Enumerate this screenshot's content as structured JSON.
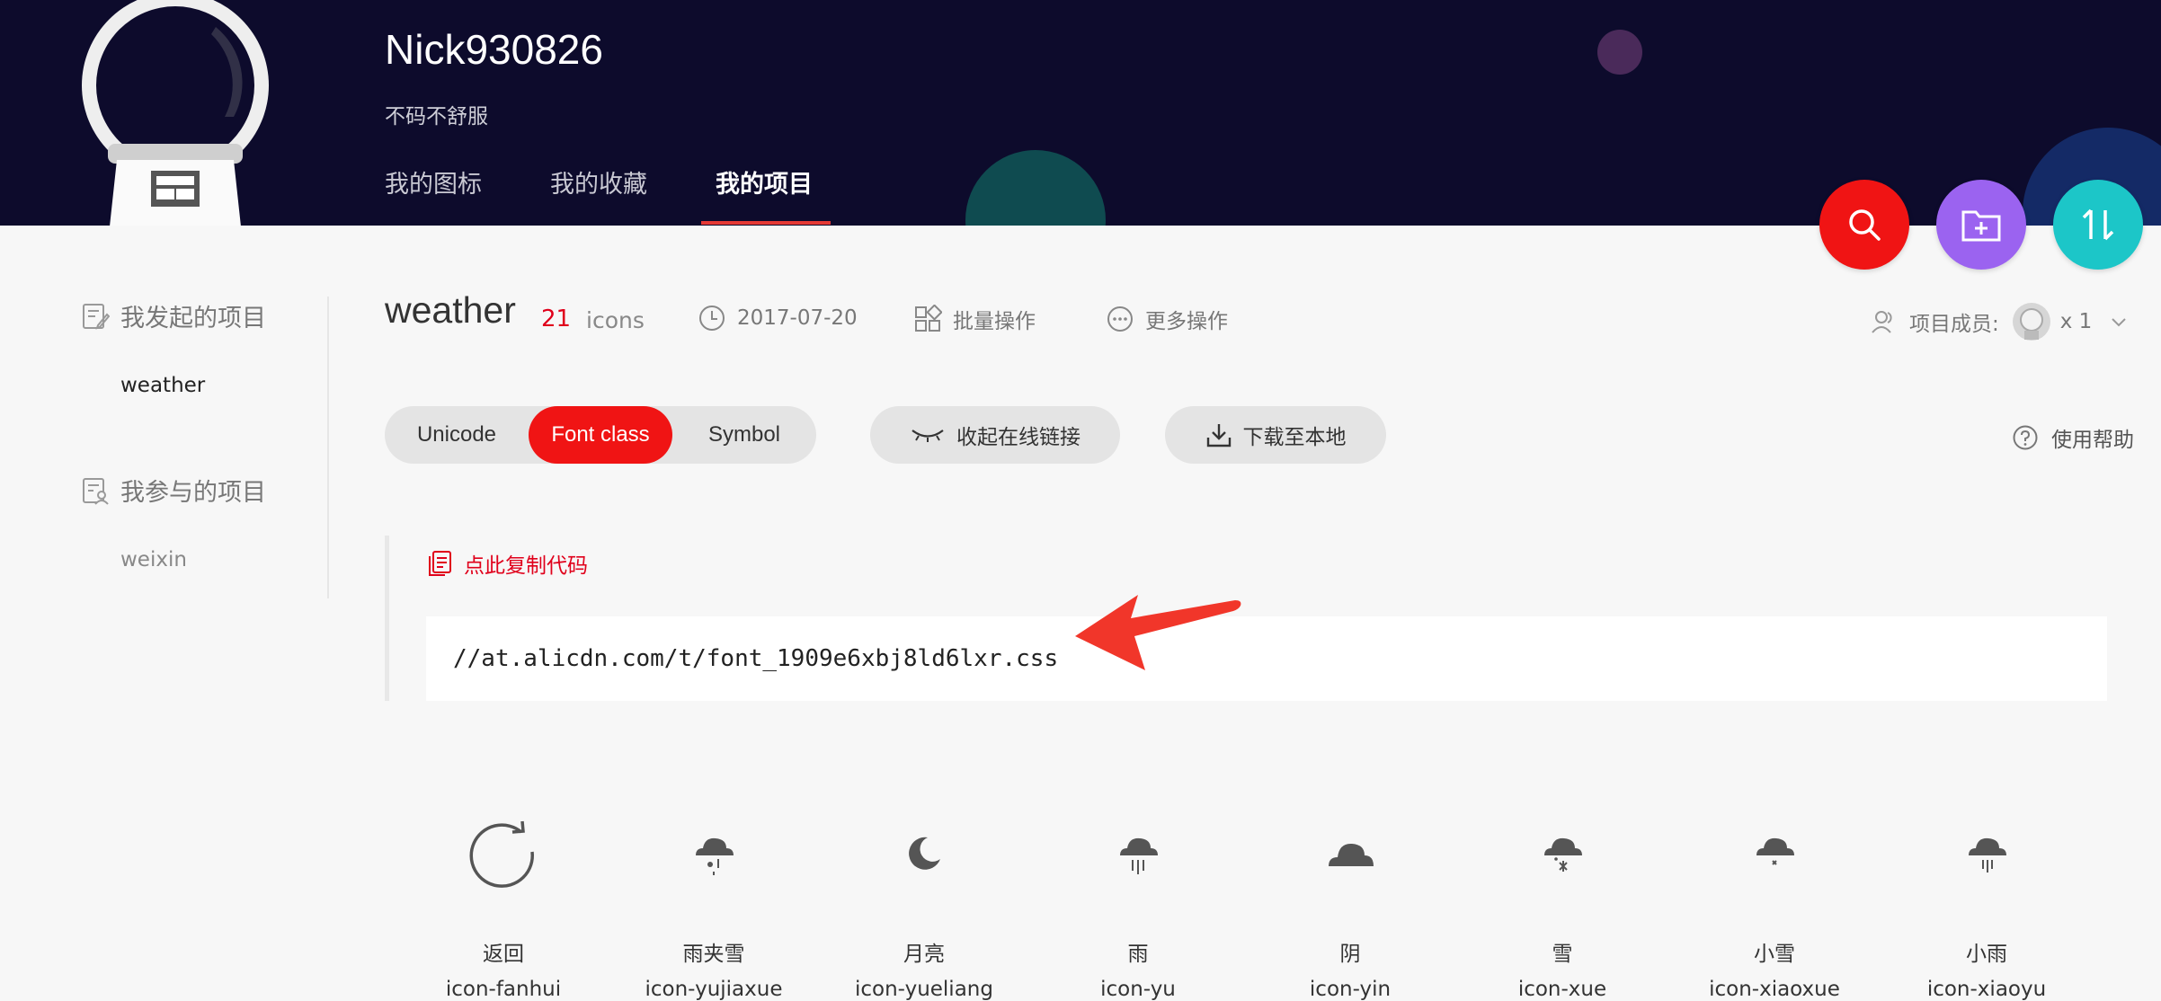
{
  "header": {
    "username": "Nick930826",
    "bio": "不码不舒服",
    "tabs": [
      {
        "label": "我的图标"
      },
      {
        "label": "我的收藏"
      },
      {
        "label": "我的项目",
        "active": true
      }
    ],
    "colors": {
      "background": "#0d0b2c",
      "active_tab_underline": "#e53935"
    }
  },
  "actions": {
    "search": {
      "icon": "search-icon",
      "color": "#f01414"
    },
    "new_folder": {
      "icon": "folder-add-icon",
      "color": "#9b63f0"
    },
    "sort": {
      "icon": "sort-icon",
      "color": "#1cc6c8"
    }
  },
  "sidebar": {
    "my_projects_heading": "我发起的项目",
    "my_projects": [
      "weather"
    ],
    "joined_projects_heading": "我参与的项目",
    "joined_projects": [
      "weixin"
    ]
  },
  "project": {
    "name": "weather",
    "icon_count": "21",
    "icon_count_label": "icons",
    "date": "2017-07-20",
    "batch_label": "批量操作",
    "more_label": "更多操作",
    "members_label": "项目成员:",
    "members_count": "x 1"
  },
  "toolbar": {
    "tabs": [
      "Unicode",
      "Font class",
      "Symbol"
    ],
    "active_tab": "Font class",
    "collapse_link_label": "收起在线链接",
    "download_label": "下载至本地",
    "help_label": "使用帮助",
    "accent": "#f01414"
  },
  "code": {
    "copy_label": "点此复制代码",
    "url": "//at.alicdn.com/t/font_1909e6xbj8ld6lxr.css"
  },
  "icons": [
    {
      "glyph": "refresh-icon",
      "name": "返回",
      "class": "icon-fanhui"
    },
    {
      "glyph": "cloud-sleet-icon",
      "name": "雨夹雪",
      "class": "icon-yujiaxue"
    },
    {
      "glyph": "moon-icon",
      "name": "月亮",
      "class": "icon-yueliang"
    },
    {
      "glyph": "cloud-rain-icon",
      "name": "雨",
      "class": "icon-yu"
    },
    {
      "glyph": "cloud-icon",
      "name": "阴",
      "class": "icon-yin"
    },
    {
      "glyph": "cloud-snow-icon",
      "name": "雪",
      "class": "icon-xue"
    },
    {
      "glyph": "cloud-light-snow-icon",
      "name": "小雪",
      "class": "icon-xiaoxue"
    },
    {
      "glyph": "cloud-light-rain-icon",
      "name": "小雨",
      "class": "icon-xiaoyu"
    }
  ]
}
